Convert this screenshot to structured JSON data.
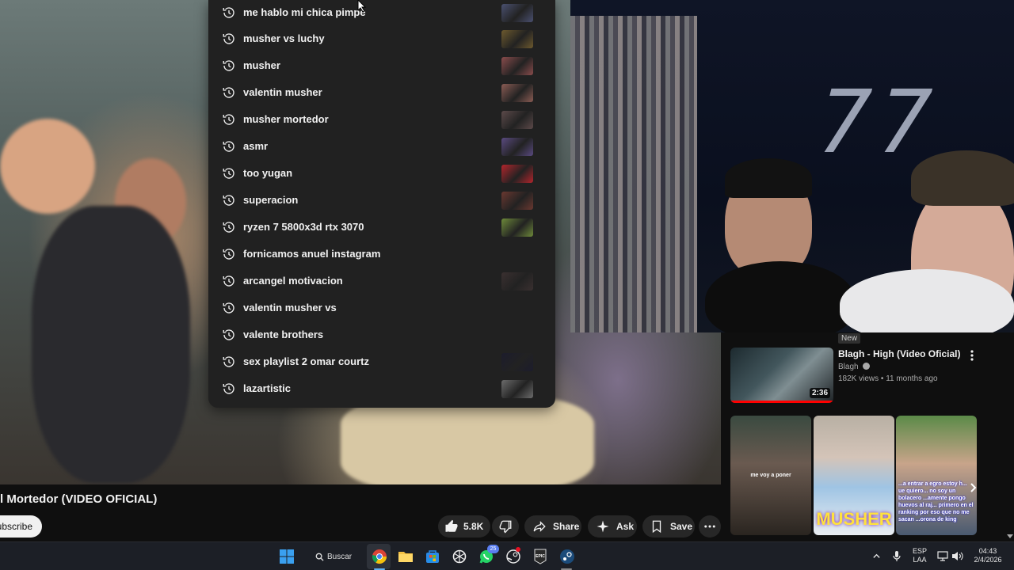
{
  "search_history": [
    {
      "label": "me hablo mi chica pimpe",
      "thumb": "#4a5070"
    },
    {
      "label": "musher vs luchy",
      "thumb": "#6d5a2e"
    },
    {
      "label": "musher",
      "thumb": "#8a4c4c"
    },
    {
      "label": "valentin musher",
      "thumb": "#8a5c54"
    },
    {
      "label": "musher mortedor",
      "thumb": "#5c4a4a"
    },
    {
      "label": "asmr",
      "thumb": "#5a4a80"
    },
    {
      "label": "too yugan",
      "thumb": "#b2252c"
    },
    {
      "label": "superacion",
      "thumb": "#6a3830"
    },
    {
      "label": "ryzen 7 5800x3d rtx 3070",
      "thumb": "#6e8a3a"
    },
    {
      "label": "fornicamos anuel instagram",
      "thumb": ""
    },
    {
      "label": "arcangel motivacion",
      "thumb": "#3a3030"
    },
    {
      "label": "valentin musher vs",
      "thumb": ""
    },
    {
      "label": "valente brothers",
      "thumb": ""
    },
    {
      "label": "sex playlist 2 omar courtz",
      "thumb": "#1c1c2c"
    },
    {
      "label": "lazartistic",
      "thumb": "#6c6c6c"
    }
  ],
  "video": {
    "title": "l Mortedor (VIDEO OFICIAL)",
    "subscribe_label": "ubscribe",
    "like_count": "5.8K",
    "share_label": "Share",
    "ask_label": "Ask",
    "save_label": "Save"
  },
  "webcam": {
    "wall_text": "77"
  },
  "related": {
    "badge": "New",
    "title": "Blagh - High (Video Oficial)",
    "channel": "Blagh",
    "meta": "182K views • 11 months ago",
    "duration": "2:36",
    "shorts": [
      {
        "caption": "me voy a poner"
      },
      {
        "caption": "MUSHER"
      },
      {
        "caption": "...a entrar a egro estoy h... ue quiero... no soy un bolacero ...amente pongo huevos al raj... primero en el ranking por eso que no me sacan ...orona de king"
      }
    ]
  },
  "taskbar": {
    "search_label": "Buscar",
    "whatsapp_badge": "25",
    "lang_top": "ESP",
    "lang_bottom": "LAA",
    "time": "04:43",
    "date": "2/4/2026"
  }
}
